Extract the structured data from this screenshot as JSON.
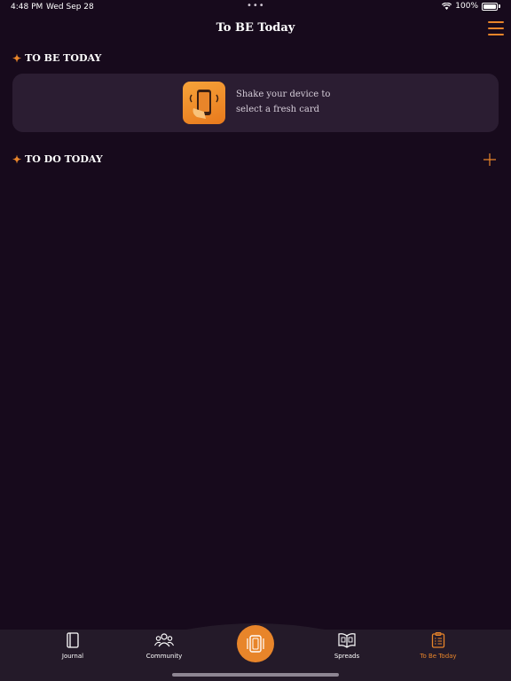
{
  "status_bar": {
    "time": "4:48 PM",
    "date": "Wed Sep 28",
    "battery": "100%",
    "battery_level": 1.0
  },
  "nav": {
    "title": "To BE Today",
    "menu_icon": "hamburger-icon"
  },
  "sections": {
    "to_be": {
      "label": "TO BE TODAY",
      "icon": "sparkle-icon"
    },
    "to_do": {
      "label": "TO DO TODAY",
      "icon": "sparkle-icon",
      "add_icon": "plus-icon"
    }
  },
  "card": {
    "icon": "shake-phone-icon",
    "line1": "Shake your device to",
    "line2": "select a fresh card"
  },
  "tabs": [
    {
      "label": "Journal",
      "icon": "journal-icon",
      "active": false
    },
    {
      "label": "Community",
      "icon": "community-icon",
      "active": false
    },
    {
      "label": "",
      "icon": "deck-icon",
      "active": false
    },
    {
      "label": "Spreads",
      "icon": "spreads-book-icon",
      "active": false
    },
    {
      "label": "To Be Today",
      "icon": "checklist-icon",
      "active": true
    }
  ],
  "colors": {
    "background": "#170a1c",
    "accent": "#e8852a",
    "card": "#2b1d32",
    "tab_bar": "#241a29"
  }
}
